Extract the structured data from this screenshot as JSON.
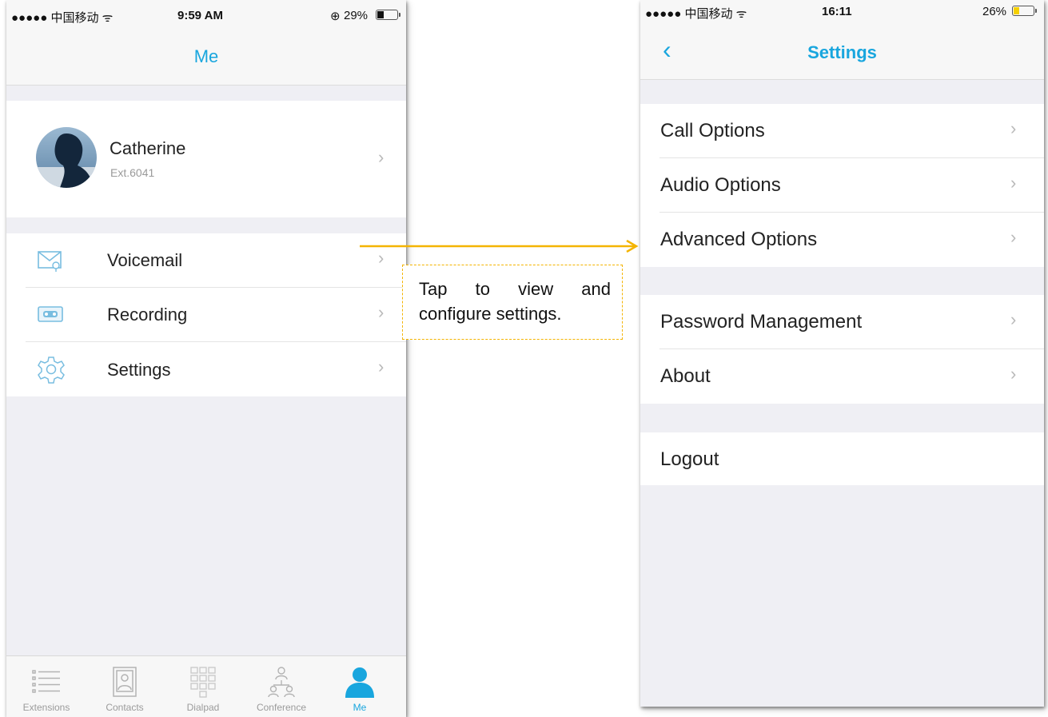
{
  "left_screen": {
    "status": {
      "carrier": "●●●●● 中国移动 ᯤ",
      "time": "9:59 AM",
      "battery": "29%",
      "battery_level": 0.29
    },
    "title": "Me",
    "profile": {
      "name": "Catherine",
      "extension": "Ext.6041"
    },
    "menu": [
      {
        "label": "Voicemail",
        "icon": "voicemail-icon"
      },
      {
        "label": "Recording",
        "icon": "recording-icon"
      },
      {
        "label": "Settings",
        "icon": "settings-gear-icon"
      }
    ],
    "tabs": [
      {
        "label": "Extensions",
        "icon": "extensions-list-icon"
      },
      {
        "label": "Contacts",
        "icon": "contacts-icon"
      },
      {
        "label": "Dialpad",
        "icon": "dialpad-icon"
      },
      {
        "label": "Conference",
        "icon": "conference-icon"
      },
      {
        "label": "Me",
        "icon": "person-icon",
        "active": true
      }
    ]
  },
  "right_screen": {
    "status": {
      "carrier": "●●●●● 中国移动 ᯤ",
      "time": "16:11",
      "battery": "26%",
      "battery_level": 0.26
    },
    "title": "Settings",
    "groups": [
      [
        "Call Options",
        "Audio Options",
        "Advanced Options"
      ],
      [
        "Password Management",
        "About"
      ],
      [
        "Logout"
      ]
    ]
  },
  "callout": {
    "text": "Tap to view and configure settings."
  },
  "colors": {
    "accent": "#19a6de",
    "callout": "#f4b400",
    "battery_low": "#f5d000"
  }
}
